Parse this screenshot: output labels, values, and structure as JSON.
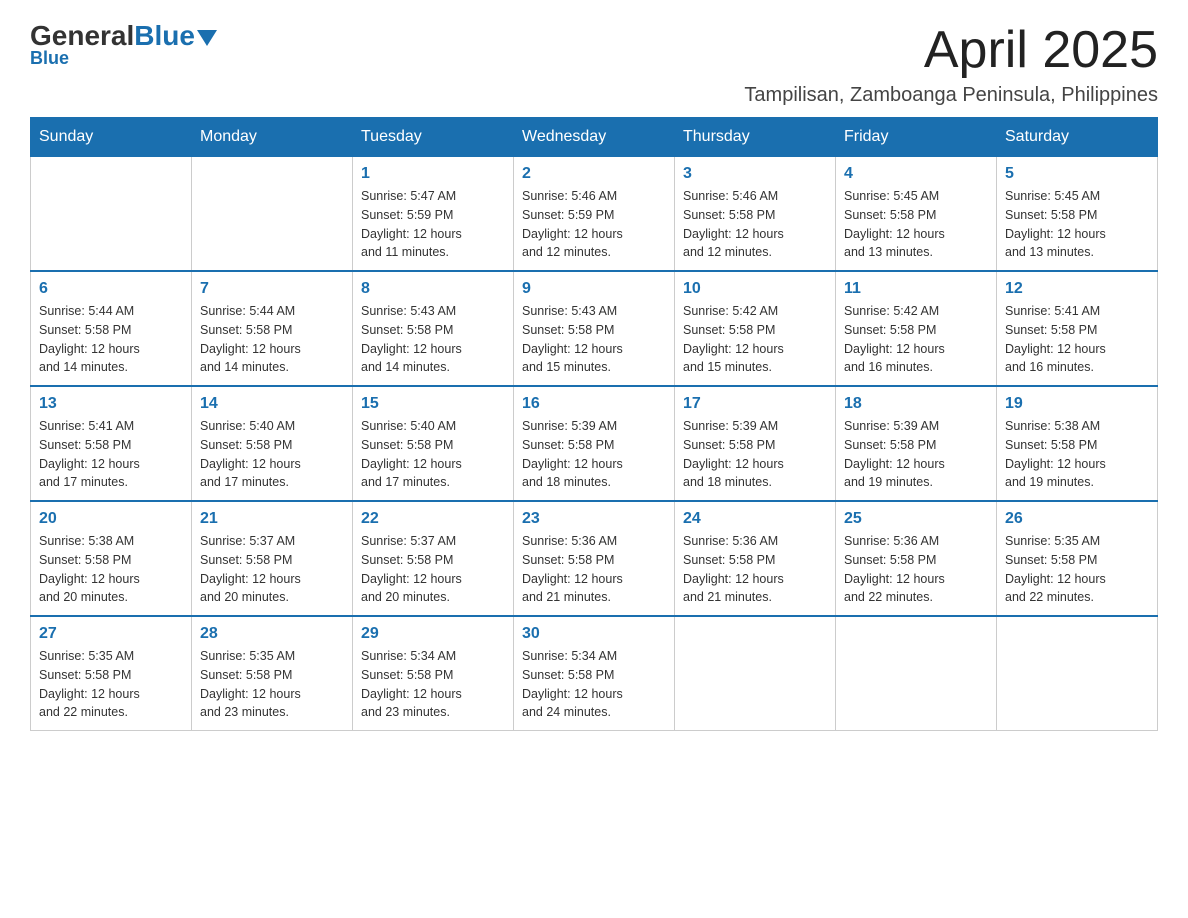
{
  "header": {
    "logo_general": "General",
    "logo_blue": "Blue",
    "month_title": "April 2025",
    "location": "Tampilisan, Zamboanga Peninsula, Philippines"
  },
  "days_of_week": [
    "Sunday",
    "Monday",
    "Tuesday",
    "Wednesday",
    "Thursday",
    "Friday",
    "Saturday"
  ],
  "weeks": [
    [
      {
        "day": "",
        "info": ""
      },
      {
        "day": "",
        "info": ""
      },
      {
        "day": "1",
        "info": "Sunrise: 5:47 AM\nSunset: 5:59 PM\nDaylight: 12 hours\nand 11 minutes."
      },
      {
        "day": "2",
        "info": "Sunrise: 5:46 AM\nSunset: 5:59 PM\nDaylight: 12 hours\nand 12 minutes."
      },
      {
        "day": "3",
        "info": "Sunrise: 5:46 AM\nSunset: 5:58 PM\nDaylight: 12 hours\nand 12 minutes."
      },
      {
        "day": "4",
        "info": "Sunrise: 5:45 AM\nSunset: 5:58 PM\nDaylight: 12 hours\nand 13 minutes."
      },
      {
        "day": "5",
        "info": "Sunrise: 5:45 AM\nSunset: 5:58 PM\nDaylight: 12 hours\nand 13 minutes."
      }
    ],
    [
      {
        "day": "6",
        "info": "Sunrise: 5:44 AM\nSunset: 5:58 PM\nDaylight: 12 hours\nand 14 minutes."
      },
      {
        "day": "7",
        "info": "Sunrise: 5:44 AM\nSunset: 5:58 PM\nDaylight: 12 hours\nand 14 minutes."
      },
      {
        "day": "8",
        "info": "Sunrise: 5:43 AM\nSunset: 5:58 PM\nDaylight: 12 hours\nand 14 minutes."
      },
      {
        "day": "9",
        "info": "Sunrise: 5:43 AM\nSunset: 5:58 PM\nDaylight: 12 hours\nand 15 minutes."
      },
      {
        "day": "10",
        "info": "Sunrise: 5:42 AM\nSunset: 5:58 PM\nDaylight: 12 hours\nand 15 minutes."
      },
      {
        "day": "11",
        "info": "Sunrise: 5:42 AM\nSunset: 5:58 PM\nDaylight: 12 hours\nand 16 minutes."
      },
      {
        "day": "12",
        "info": "Sunrise: 5:41 AM\nSunset: 5:58 PM\nDaylight: 12 hours\nand 16 minutes."
      }
    ],
    [
      {
        "day": "13",
        "info": "Sunrise: 5:41 AM\nSunset: 5:58 PM\nDaylight: 12 hours\nand 17 minutes."
      },
      {
        "day": "14",
        "info": "Sunrise: 5:40 AM\nSunset: 5:58 PM\nDaylight: 12 hours\nand 17 minutes."
      },
      {
        "day": "15",
        "info": "Sunrise: 5:40 AM\nSunset: 5:58 PM\nDaylight: 12 hours\nand 17 minutes."
      },
      {
        "day": "16",
        "info": "Sunrise: 5:39 AM\nSunset: 5:58 PM\nDaylight: 12 hours\nand 18 minutes."
      },
      {
        "day": "17",
        "info": "Sunrise: 5:39 AM\nSunset: 5:58 PM\nDaylight: 12 hours\nand 18 minutes."
      },
      {
        "day": "18",
        "info": "Sunrise: 5:39 AM\nSunset: 5:58 PM\nDaylight: 12 hours\nand 19 minutes."
      },
      {
        "day": "19",
        "info": "Sunrise: 5:38 AM\nSunset: 5:58 PM\nDaylight: 12 hours\nand 19 minutes."
      }
    ],
    [
      {
        "day": "20",
        "info": "Sunrise: 5:38 AM\nSunset: 5:58 PM\nDaylight: 12 hours\nand 20 minutes."
      },
      {
        "day": "21",
        "info": "Sunrise: 5:37 AM\nSunset: 5:58 PM\nDaylight: 12 hours\nand 20 minutes."
      },
      {
        "day": "22",
        "info": "Sunrise: 5:37 AM\nSunset: 5:58 PM\nDaylight: 12 hours\nand 20 minutes."
      },
      {
        "day": "23",
        "info": "Sunrise: 5:36 AM\nSunset: 5:58 PM\nDaylight: 12 hours\nand 21 minutes."
      },
      {
        "day": "24",
        "info": "Sunrise: 5:36 AM\nSunset: 5:58 PM\nDaylight: 12 hours\nand 21 minutes."
      },
      {
        "day": "25",
        "info": "Sunrise: 5:36 AM\nSunset: 5:58 PM\nDaylight: 12 hours\nand 22 minutes."
      },
      {
        "day": "26",
        "info": "Sunrise: 5:35 AM\nSunset: 5:58 PM\nDaylight: 12 hours\nand 22 minutes."
      }
    ],
    [
      {
        "day": "27",
        "info": "Sunrise: 5:35 AM\nSunset: 5:58 PM\nDaylight: 12 hours\nand 22 minutes."
      },
      {
        "day": "28",
        "info": "Sunrise: 5:35 AM\nSunset: 5:58 PM\nDaylight: 12 hours\nand 23 minutes."
      },
      {
        "day": "29",
        "info": "Sunrise: 5:34 AM\nSunset: 5:58 PM\nDaylight: 12 hours\nand 23 minutes."
      },
      {
        "day": "30",
        "info": "Sunrise: 5:34 AM\nSunset: 5:58 PM\nDaylight: 12 hours\nand 24 minutes."
      },
      {
        "day": "",
        "info": ""
      },
      {
        "day": "",
        "info": ""
      },
      {
        "day": "",
        "info": ""
      }
    ]
  ]
}
